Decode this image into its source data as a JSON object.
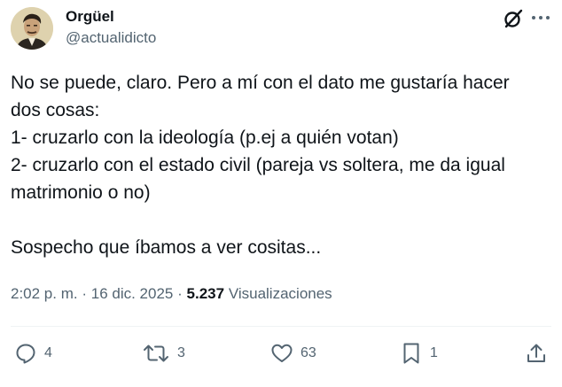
{
  "author": {
    "display_name": "Orgüel",
    "handle": "@actualidicto"
  },
  "header_icons": [
    "grok-icon",
    "more-icon"
  ],
  "tweet": {
    "text": "No se puede, claro. Pero a mí con el dato me gustaría hacer\ndos cosas:\n1- cruzarlo con la ideología (p.ej a quién votan)\n2- cruzarlo con el estado civil (pareja vs soltera, me da igual\nmatrimonio o no)\n\nSospecho que íbamos a ver cositas..."
  },
  "meta": {
    "time": "2:02 p. m.",
    "separator": "·",
    "date": "16 dic. 2025",
    "views_count": "5.237",
    "views_label": "Visualizaciones"
  },
  "actions": {
    "replies": "4",
    "reposts": "3",
    "likes": "63",
    "bookmarks": "1"
  },
  "colors": {
    "text": "#0f1419",
    "secondary": "#536471",
    "divider": "#eff3f4"
  }
}
